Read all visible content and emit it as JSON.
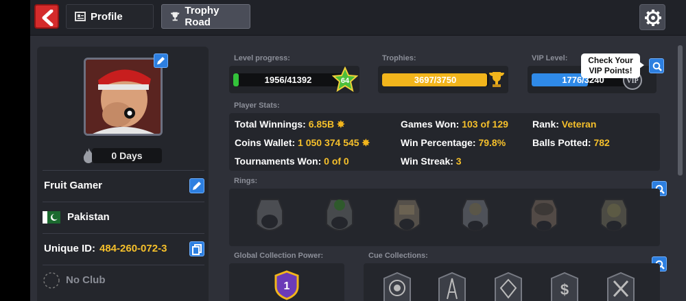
{
  "topbar": {
    "profile_tab": "Profile",
    "trophy_tab": "Trophy Road"
  },
  "profile": {
    "days": "0 Days",
    "name": "Fruit Gamer",
    "country": "Pakistan",
    "unique_id_label": "Unique ID:",
    "unique_id": "484-260-072-3",
    "club": "No Club"
  },
  "progress": {
    "level_label": "Level progress:",
    "level_value": "1956/41392",
    "level_fraction": 0.047,
    "level_number": "64",
    "trophies_label": "Trophies:",
    "trophies_value": "3697/3750",
    "trophies_fraction": 0.986,
    "vip_label": "VIP Level:",
    "vip_value": "1776/3240",
    "vip_fraction": 0.548,
    "vip_badge": "VIP",
    "tooltip": "Check Your VIP Points!"
  },
  "stats": {
    "section_label": "Player Stats:",
    "total_winnings_label": "Total Winnings:",
    "total_winnings": "6.85B",
    "coins_wallet_label": "Coins Wallet:",
    "coins_wallet": "1 050 374 545",
    "tournaments_won_label": "Tournaments Won:",
    "tournaments_won": "0 of 0",
    "games_won_label": "Games Won:",
    "games_won": "103 of 129",
    "win_percentage_label": "Win Percentage:",
    "win_percentage": "79.8%",
    "win_streak_label": "Win Streak:",
    "win_streak": "3",
    "rank_label": "Rank:",
    "rank": "Veteran",
    "balls_potted_label": "Balls Potted:",
    "balls_potted": "782"
  },
  "rings": {
    "section_label": "Rings:"
  },
  "collection": {
    "gcp_label": "Global Collection Power:",
    "gcp_value": "1",
    "cue_label": "Cue Collections:"
  },
  "colors": {
    "accent": "#f6c02b",
    "blue": "#2d7fe0",
    "red": "#d42b2b"
  }
}
